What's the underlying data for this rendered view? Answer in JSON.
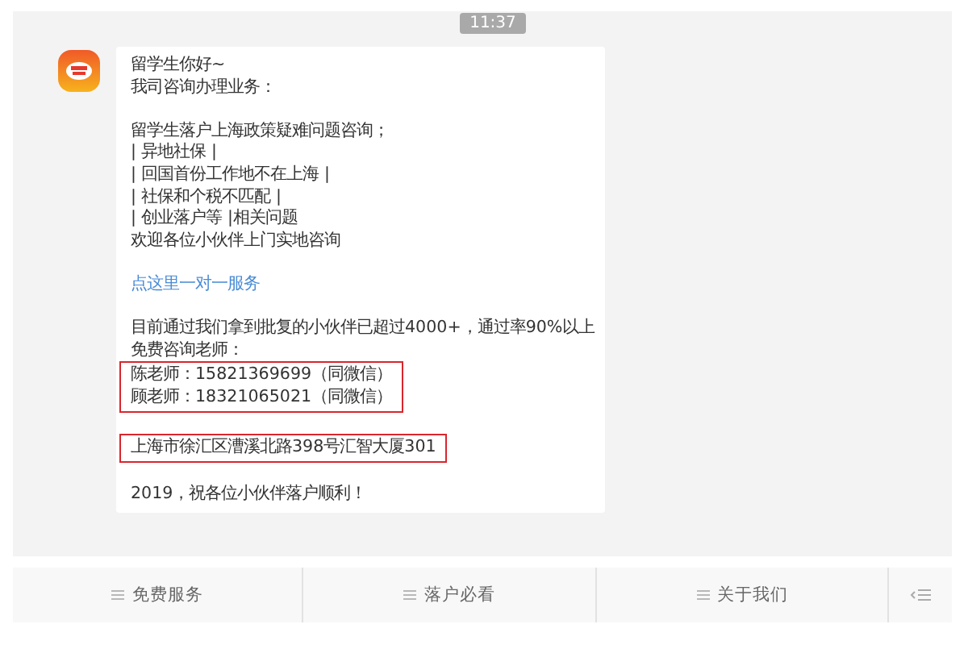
{
  "time": "11:37",
  "message": [
    {
      "kind": "text",
      "text": "留学生你好~"
    },
    {
      "kind": "text",
      "text": "我司咨询办理业务："
    },
    {
      "kind": "blank"
    },
    {
      "kind": "text",
      "text": "留学生落户上海政策疑难问题咨询；"
    },
    {
      "kind": "text",
      "text": "| 异地社保 |"
    },
    {
      "kind": "text",
      "text": "| 回国首份工作地不在上海 |"
    },
    {
      "kind": "text",
      "text": "| 社保和个税不匹配 |"
    },
    {
      "kind": "text",
      "text": "| 创业落户等 |相关问题"
    },
    {
      "kind": "text",
      "text": "欢迎各位小伙伴上门实地咨询"
    },
    {
      "kind": "blank"
    },
    {
      "kind": "link",
      "text": "点这里一对一服务"
    },
    {
      "kind": "blank"
    },
    {
      "kind": "text",
      "text": "目前通过我们拿到批复的小伙伴已超过4000+，通过率90%以上"
    },
    {
      "kind": "text",
      "text": "免费咨询老师："
    },
    {
      "kind": "boxed",
      "lines": [
        "陈老师：15821369699（同微信）",
        "顾老师：18321065021（同微信）"
      ]
    },
    {
      "kind": "blank"
    },
    {
      "kind": "boxed",
      "lines": [
        "上海市徐汇区漕溪北路398号汇智大厦301"
      ]
    },
    {
      "kind": "blank"
    },
    {
      "kind": "text",
      "text": "2019，祝各位小伙伴落户顺利！"
    }
  ],
  "menu": [
    "免费服务",
    "落户必看",
    "关于我们"
  ]
}
